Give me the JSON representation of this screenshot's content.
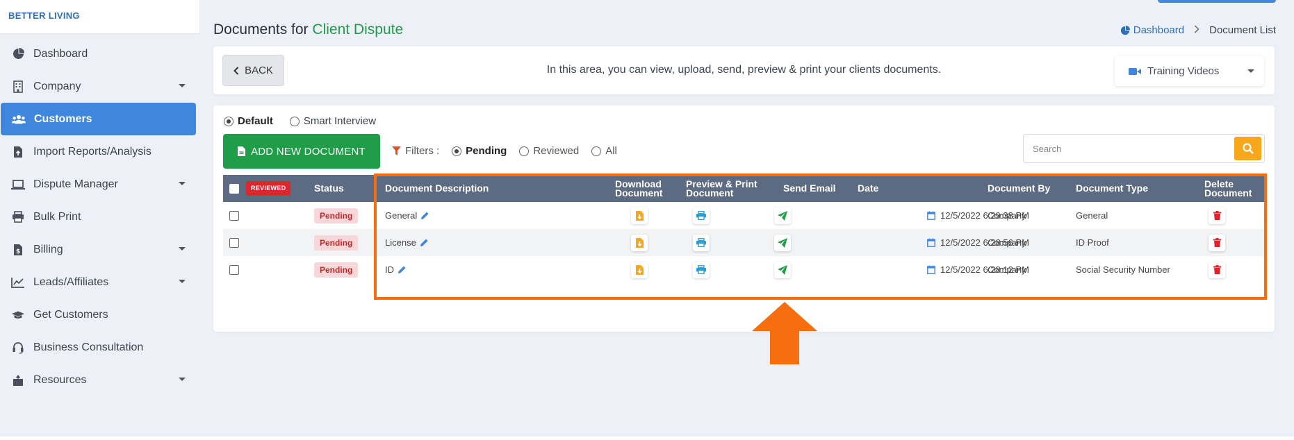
{
  "app": {
    "brand": "BETTER LIVING"
  },
  "sidebar": {
    "items": [
      {
        "label": "Dashboard",
        "icon": "pie-chart-icon",
        "has_caret": false,
        "active": false
      },
      {
        "label": "Company",
        "icon": "building-icon",
        "has_caret": true,
        "active": false
      },
      {
        "label": "Customers",
        "icon": "users-icon",
        "has_caret": false,
        "active": true
      },
      {
        "label": "Import Reports/Analysis",
        "icon": "file-upload-icon",
        "has_caret": false,
        "active": false
      },
      {
        "label": "Dispute Manager",
        "icon": "laptop-icon",
        "has_caret": true,
        "active": false
      },
      {
        "label": "Bulk Print",
        "icon": "printer-icon",
        "has_caret": false,
        "active": false
      },
      {
        "label": "Billing",
        "icon": "invoice-icon",
        "has_caret": true,
        "active": false
      },
      {
        "label": "Leads/Affiliates",
        "icon": "line-chart-icon",
        "has_caret": true,
        "active": false
      },
      {
        "label": "Get Customers",
        "icon": "graduation-cap-icon",
        "has_caret": false,
        "active": false
      },
      {
        "label": "Business Consultation",
        "icon": "headset-icon",
        "has_caret": false,
        "active": false
      },
      {
        "label": "Resources",
        "icon": "box-icon",
        "has_caret": true,
        "active": false
      }
    ]
  },
  "header": {
    "title_prefix": "Documents for",
    "client_name": "Client Dispute",
    "breadcrumb_home": "Dashboard",
    "breadcrumb_current": "Document List"
  },
  "info": {
    "back_label": "BACK",
    "description": "In this area, you can view, upload, send, preview & print your clients documents.",
    "training_label": "Training Videos"
  },
  "mode": {
    "options": [
      "Default",
      "Smart Interview"
    ],
    "selected": "Default"
  },
  "actions": {
    "add_document_label": "ADD NEW DOCUMENT"
  },
  "filters": {
    "label": "Filters :",
    "options": [
      "Pending",
      "Reviewed",
      "All"
    ],
    "selected": "Pending"
  },
  "search": {
    "placeholder": "Search",
    "value": ""
  },
  "table": {
    "reviewed_button": "REVIEWED",
    "columns": {
      "status": "Status",
      "description": "Document Description",
      "download": "Download Document",
      "preview": "Preview & Print Document",
      "email": "Send Email",
      "date": "Date",
      "by": "Document By",
      "type": "Document Type",
      "delete": "Delete Document"
    },
    "rows": [
      {
        "status": "Pending",
        "description": "General",
        "date": "12/5/2022 6:29:38 PM",
        "by": "Company",
        "type": "General"
      },
      {
        "status": "Pending",
        "description": "License",
        "date": "12/5/2022 6:28:56 PM",
        "by": "Company",
        "type": "ID Proof"
      },
      {
        "status": "Pending",
        "description": "ID",
        "date": "12/5/2022 6:28:12 PM",
        "by": "Company",
        "type": "Social Security Number"
      }
    ]
  },
  "colors": {
    "primary": "#3f86df",
    "success": "#1f9d48",
    "warning": "#f6a81a",
    "danger": "#e0242d",
    "table_header": "#5d6b82",
    "annotation": "#f66e0f"
  }
}
